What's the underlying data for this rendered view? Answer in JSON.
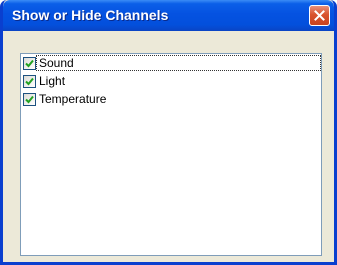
{
  "window": {
    "title": "Show or Hide Channels"
  },
  "channels": [
    {
      "label": "Sound",
      "checked": true
    },
    {
      "label": "Light",
      "checked": true
    },
    {
      "label": "Temperature",
      "checked": true
    }
  ],
  "colors": {
    "titlebar": "#0552e1",
    "close_button": "#d9532e",
    "check_mark": "#21a121",
    "dialog_background": "#ece9d8"
  },
  "icons": {
    "close": "close-icon",
    "check": "check-mark-icon"
  }
}
